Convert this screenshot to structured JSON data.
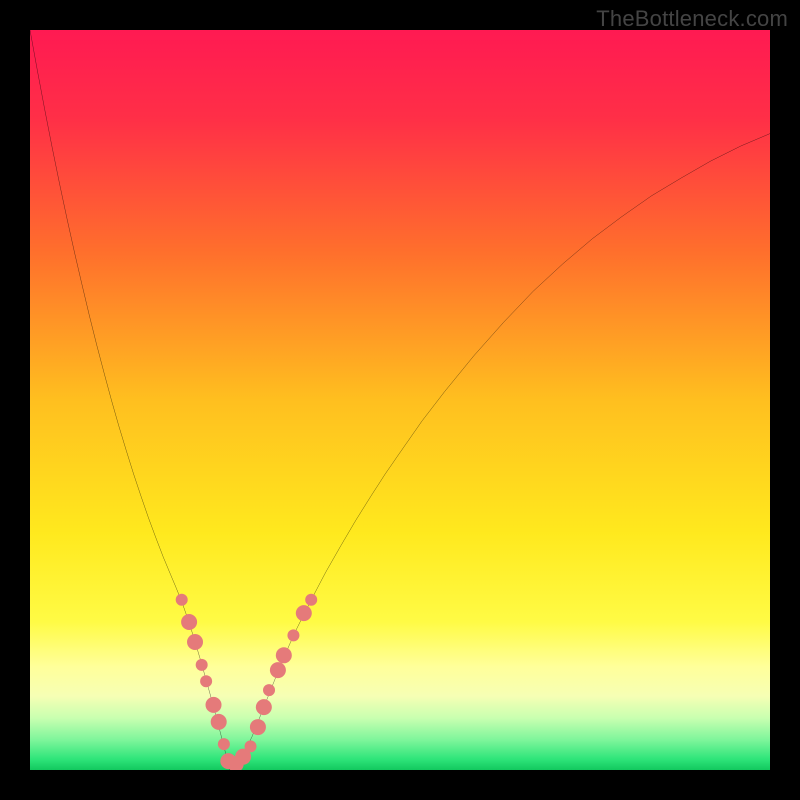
{
  "watermark": "TheBottleneck.com",
  "chart_data": {
    "type": "line",
    "title": "",
    "xlabel": "",
    "ylabel": "",
    "xlim": [
      0,
      100
    ],
    "ylim": [
      0,
      100
    ],
    "grid": false,
    "legend": false,
    "annotations": [],
    "background_gradient": {
      "stops": [
        {
          "pos": 0.0,
          "color": "#ff1a52"
        },
        {
          "pos": 0.12,
          "color": "#ff2f47"
        },
        {
          "pos": 0.3,
          "color": "#ff6f2c"
        },
        {
          "pos": 0.5,
          "color": "#ffbf1f"
        },
        {
          "pos": 0.68,
          "color": "#ffe91e"
        },
        {
          "pos": 0.8,
          "color": "#fffb45"
        },
        {
          "pos": 0.86,
          "color": "#ffff9a"
        },
        {
          "pos": 0.9,
          "color": "#f6ffb4"
        },
        {
          "pos": 0.93,
          "color": "#c8ffb0"
        },
        {
          "pos": 0.96,
          "color": "#7cf59a"
        },
        {
          "pos": 0.985,
          "color": "#2fe57a"
        },
        {
          "pos": 1.0,
          "color": "#12c85e"
        }
      ]
    },
    "series": [
      {
        "name": "left-curve",
        "stroke": "#000000",
        "x": [
          0,
          1,
          2,
          3,
          4,
          5,
          6,
          7,
          8,
          9,
          10,
          11,
          12,
          13,
          14,
          15,
          16,
          17,
          18,
          19,
          19.8,
          20.6,
          21.4,
          22.2,
          23,
          23.8,
          24.6,
          25.4,
          26.2,
          27
        ],
        "y": [
          100,
          94.5,
          89.2,
          84.1,
          79.2,
          74.5,
          70.0,
          65.7,
          61.5,
          57.5,
          53.7,
          50.0,
          46.5,
          43.2,
          40.0,
          37.0,
          34.1,
          31.4,
          28.8,
          26.4,
          24.5,
          22.5,
          20.2,
          17.7,
          15.0,
          12.2,
          9.3,
          6.3,
          3.2,
          0.0
        ]
      },
      {
        "name": "right-curve",
        "stroke": "#000000",
        "x": [
          27,
          28,
          29,
          30,
          31,
          32,
          33,
          34,
          35,
          36,
          38,
          40,
          42,
          44,
          46,
          48,
          50,
          53,
          56,
          60,
          64,
          68,
          72,
          76,
          80,
          84,
          88,
          92,
          96,
          100
        ],
        "y": [
          0.0,
          1.0,
          2.5,
          4.5,
          7.0,
          9.5,
          12.0,
          14.5,
          16.8,
          19.0,
          23.0,
          26.8,
          30.3,
          33.7,
          36.9,
          40.0,
          42.9,
          47.2,
          51.1,
          56.0,
          60.5,
          64.7,
          68.4,
          71.8,
          74.8,
          77.6,
          80.0,
          82.3,
          84.3,
          86.0
        ]
      }
    ],
    "markers": {
      "color": "#e57a7a",
      "points": [
        {
          "x": 20.5,
          "y": 23.0,
          "r": 6
        },
        {
          "x": 21.5,
          "y": 20.0,
          "r": 8
        },
        {
          "x": 22.3,
          "y": 17.3,
          "r": 8
        },
        {
          "x": 23.2,
          "y": 14.2,
          "r": 6
        },
        {
          "x": 23.8,
          "y": 12.0,
          "r": 6
        },
        {
          "x": 24.8,
          "y": 8.8,
          "r": 8
        },
        {
          "x": 25.5,
          "y": 6.5,
          "r": 8
        },
        {
          "x": 26.2,
          "y": 3.5,
          "r": 6
        },
        {
          "x": 26.8,
          "y": 1.2,
          "r": 8
        },
        {
          "x": 27.8,
          "y": 0.8,
          "r": 8
        },
        {
          "x": 28.8,
          "y": 1.8,
          "r": 8
        },
        {
          "x": 29.8,
          "y": 3.2,
          "r": 6
        },
        {
          "x": 30.8,
          "y": 5.8,
          "r": 8
        },
        {
          "x": 31.6,
          "y": 8.5,
          "r": 8
        },
        {
          "x": 32.3,
          "y": 10.8,
          "r": 6
        },
        {
          "x": 33.5,
          "y": 13.5,
          "r": 8
        },
        {
          "x": 34.3,
          "y": 15.5,
          "r": 8
        },
        {
          "x": 35.6,
          "y": 18.2,
          "r": 6
        },
        {
          "x": 37.0,
          "y": 21.2,
          "r": 8
        },
        {
          "x": 38.0,
          "y": 23.0,
          "r": 6
        }
      ]
    }
  }
}
